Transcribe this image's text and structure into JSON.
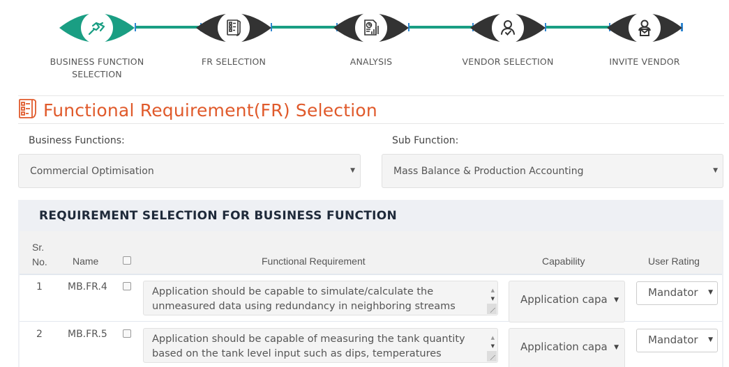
{
  "stepper": {
    "steps": [
      {
        "label_line1": "BUSINESS FUNCTION",
        "label_line2": "SELECTION",
        "icon": "handshake-icon",
        "state": "active"
      },
      {
        "label_line1": "FR SELECTION",
        "label_line2": "",
        "icon": "checklist-icon",
        "state": "inactive"
      },
      {
        "label_line1": "ANALYSIS",
        "label_line2": "",
        "icon": "report-chart-icon",
        "state": "inactive"
      },
      {
        "label_line1": "VENDOR SELECTION",
        "label_line2": "",
        "icon": "user-check-icon",
        "state": "inactive"
      },
      {
        "label_line1": "INVITE VENDOR",
        "label_line2": "",
        "icon": "user-mail-icon",
        "state": "inactive"
      }
    ],
    "colors": {
      "active": "#1a9e83",
      "inactive": "#333333",
      "connector": "#1a9e83"
    }
  },
  "page": {
    "title": "Functional Requirement(FR) Selection",
    "title_icon": "checklist-icon",
    "title_color": "#e05a2b"
  },
  "filters": {
    "business_functions": {
      "label": "Business Functions:",
      "value": "Commercial Optimisation"
    },
    "sub_function": {
      "label": "Sub Function:",
      "value": "Mass Balance & Production Accounting"
    }
  },
  "table": {
    "heading": "REQUIREMENT SELECTION FOR BUSINESS FUNCTION",
    "columns": {
      "sr_no_line1": "Sr.",
      "sr_no_line2": "No.",
      "name": "Name",
      "functional_requirement": "Functional Requirement",
      "capability": "Capability",
      "user_rating": "User Rating"
    },
    "rows": [
      {
        "sr": "1",
        "name": "MB.FR.4",
        "checked": false,
        "requirement": "Application should be capable to simulate/calculate the unmeasured data using redundancy in neighboring streams",
        "capability": "Application capa",
        "user_rating": "Mandator"
      },
      {
        "sr": "2",
        "name": "MB.FR.5",
        "checked": false,
        "requirement": "Application should be capable of measuring the tank quantity based on the tank level input such as dips, temperatures",
        "capability": "Application capa",
        "user_rating": "Mandator"
      }
    ]
  }
}
